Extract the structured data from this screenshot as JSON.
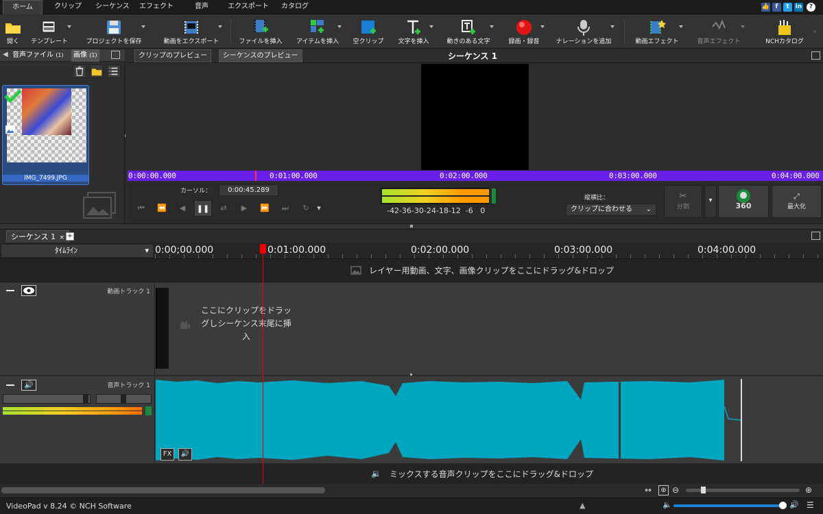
{
  "menu": {
    "items": [
      "ホーム",
      "クリップ",
      "シーケンス",
      "エフェクト",
      "音声",
      "エクスポート",
      "カタログ"
    ],
    "active": "ホーム"
  },
  "social_icons": [
    "thumbs-up-icon",
    "facebook-icon",
    "twitter-icon",
    "linkedin-icon",
    "help-icon"
  ],
  "toolbar": {
    "open": "開く",
    "template": "テンプレート",
    "save_project": "プロジェクトを保存",
    "export_video": "動画をエクスポート",
    "insert_file": "ファイルを挿入",
    "insert_item": "アイテムを挿入",
    "empty_clip": "空クリップ",
    "insert_text": "文字を挿入",
    "animated_text": "動きのある文字",
    "record": "録画・録音",
    "add_narration": "ナレーションを追加",
    "video_effects": "動画エフェクト",
    "audio_effects": "音声エフェクト",
    "nch_catalog": "NCHカタログ"
  },
  "left_panel": {
    "tab_audio": "音声ファイル",
    "tab_audio_count": "(1)",
    "tab_image": "画像",
    "tab_image_count": "(1)",
    "thumb_name": "IMG_7499.JPG"
  },
  "preview": {
    "tab_clip": "クリップのプレビュー",
    "tab_sequence": "シーケンスのプレビュー",
    "title": "シーケンス 1",
    "times": [
      "0:00:00.000",
      "0:01:00.000",
      "0:02:00.000",
      "0:03:00.000",
      "0:04:00.000"
    ],
    "cursor_label": "カーソル：",
    "cursor_value": "0:00:45.289",
    "meter_labels": "-42-36-30-24-18-12  -6   0",
    "aspect_label": "縦横比：",
    "aspect_value": "クリップに合わせる",
    "split_label": "分割",
    "vr_label": "360",
    "maximize_label": "最大化"
  },
  "timeline": {
    "tab": "シーケンス 1",
    "mode": "ﾀｲﾑﾗｲﾝ",
    "times": [
      "0:00;00.000",
      "0:01:00.000",
      "0:02:00.000",
      "0:03:00.000",
      "0:04:00.000"
    ],
    "overlay_drop": "レイヤー用動画、文字、画像クリップをここにドラッグ&ドロップ",
    "video_track_name": "動画トラック 1",
    "video_drop": "ここにクリップをドラッグしシーケンス末尾に挿入",
    "audio_track_name": "音声トラック 1",
    "audio_drop": "ミックスする音声クリップをここにドラッグ&ドロップ",
    "fx_label": "FX"
  },
  "status": {
    "version": "VideoPad v 8.24 © NCH Software"
  },
  "colors": {
    "accent_purple": "#6a1fe8",
    "waveform": "#00a5c0",
    "playhead": "#e00000"
  }
}
